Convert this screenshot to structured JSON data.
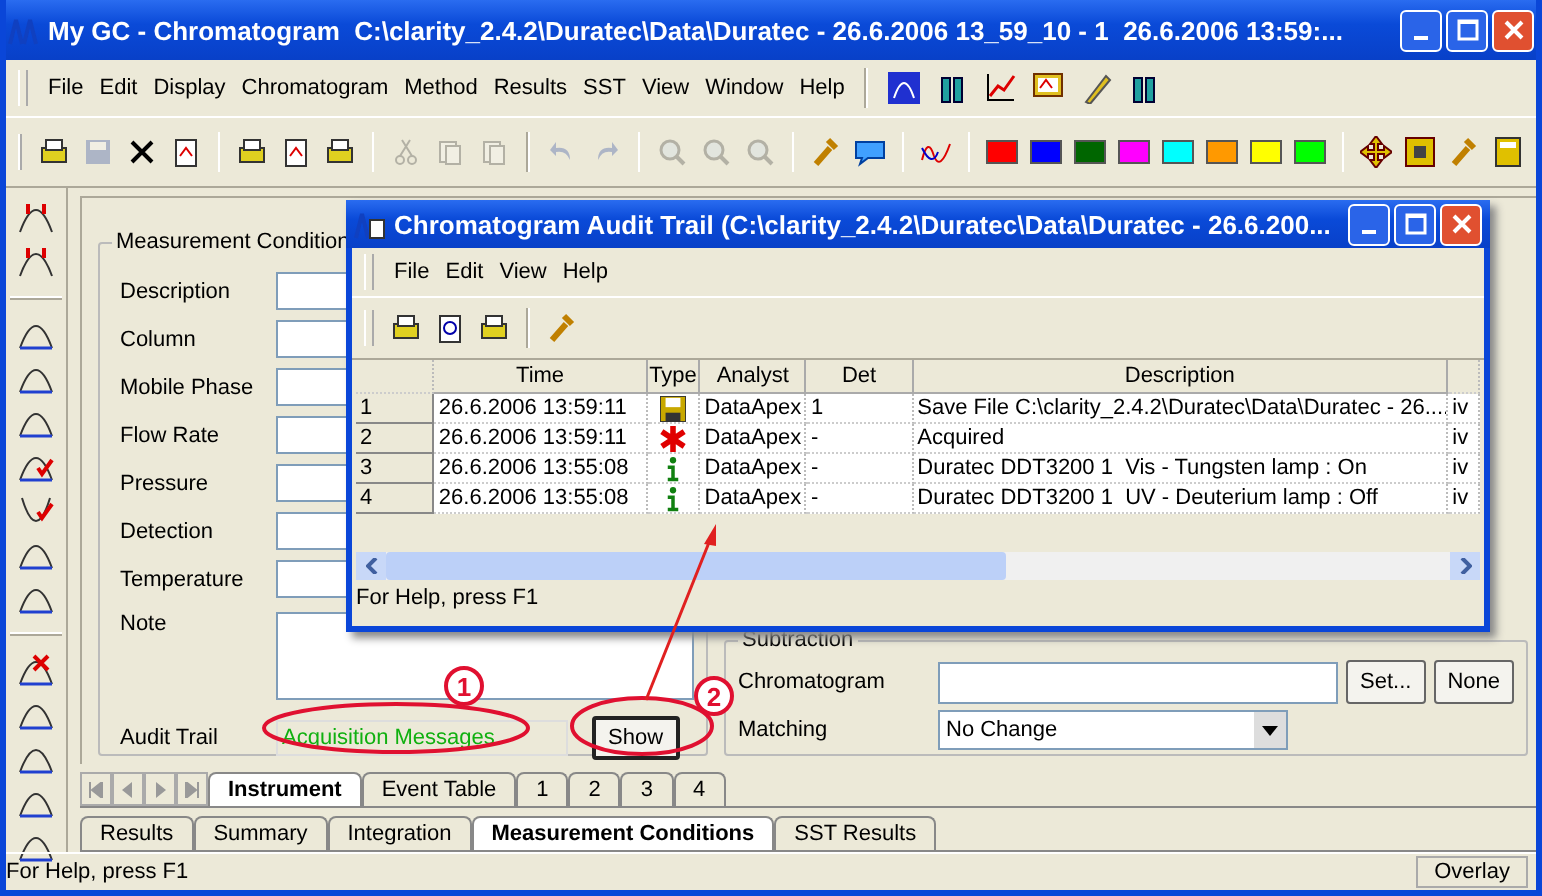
{
  "window": {
    "title": "My GC - Chromatogram  C:\\clarity_2.4.2\\Duratec\\Data\\Duratec - 26.6.2006 13_59_10 - 1  26.6.2006 13:59:..."
  },
  "menu": [
    "File",
    "Edit",
    "Display",
    "Chromatogram",
    "Method",
    "Results",
    "SST",
    "View",
    "Window",
    "Help"
  ],
  "menu_icons": [
    {
      "kind": "peak-box"
    },
    {
      "kind": "vials"
    },
    {
      "kind": "graph"
    },
    {
      "kind": "monitor"
    },
    {
      "kind": "pen"
    },
    {
      "kind": "vials"
    }
  ],
  "toolbar": [
    {
      "kind": "open",
      "disabled": false
    },
    {
      "kind": "save",
      "disabled": true
    },
    {
      "kind": "delete",
      "disabled": false
    },
    {
      "kind": "export",
      "disabled": false
    },
    {
      "kind": "sep"
    },
    {
      "kind": "open",
      "disabled": false
    },
    {
      "kind": "preview",
      "disabled": false
    },
    {
      "kind": "printer",
      "disabled": false
    },
    {
      "kind": "sep"
    },
    {
      "kind": "cut",
      "disabled": true
    },
    {
      "kind": "copy",
      "disabled": true
    },
    {
      "kind": "paste",
      "disabled": true
    },
    {
      "kind": "sep"
    },
    {
      "kind": "undo",
      "disabled": true
    },
    {
      "kind": "redo",
      "disabled": true
    },
    {
      "kind": "sep"
    },
    {
      "kind": "zoom",
      "disabled": true
    },
    {
      "kind": "zoom",
      "disabled": true
    },
    {
      "kind": "zoom",
      "disabled": true
    },
    {
      "kind": "sep"
    },
    {
      "kind": "wrench",
      "disabled": false
    },
    {
      "kind": "comment",
      "disabled": false
    },
    {
      "kind": "sep"
    },
    {
      "kind": "wave",
      "disabled": false
    },
    {
      "kind": "sep"
    },
    {
      "kind": "swatch",
      "color": "#ff0000"
    },
    {
      "kind": "swatch",
      "color": "#0000ff"
    },
    {
      "kind": "swatch",
      "color": "#006600"
    },
    {
      "kind": "swatch",
      "color": "#ff00ff"
    },
    {
      "kind": "swatch",
      "color": "#00ffff"
    },
    {
      "kind": "swatch",
      "color": "#ff9900"
    },
    {
      "kind": "swatch",
      "color": "#ffff00"
    },
    {
      "kind": "swatch",
      "color": "#00ff00"
    },
    {
      "kind": "sep"
    },
    {
      "kind": "move",
      "disabled": false
    },
    {
      "kind": "fit",
      "disabled": false
    },
    {
      "kind": "wrench",
      "disabled": false
    },
    {
      "kind": "calc",
      "disabled": false
    }
  ],
  "side_toolbar": [
    {
      "kind": "peak-mark"
    },
    {
      "kind": "peak-mark"
    },
    {
      "kind": "sep"
    },
    {
      "kind": "peak"
    },
    {
      "kind": "peak"
    },
    {
      "kind": "peak"
    },
    {
      "kind": "peak-check"
    },
    {
      "kind": "valley-check"
    },
    {
      "kind": "peak"
    },
    {
      "kind": "peak"
    },
    {
      "kind": "sep"
    },
    {
      "kind": "peak-cross"
    },
    {
      "kind": "peak"
    },
    {
      "kind": "peak"
    },
    {
      "kind": "peak"
    },
    {
      "kind": "peak"
    }
  ],
  "measurement_conditions": {
    "title": "Measurement Condition",
    "fields": [
      {
        "label": "Description"
      },
      {
        "label": "Column"
      },
      {
        "label": "Mobile Phase"
      },
      {
        "label": "Flow Rate"
      },
      {
        "label": "Pressure"
      },
      {
        "label": "Detection"
      },
      {
        "label": "Temperature"
      }
    ],
    "note_label": "Note",
    "audit_trail": {
      "label": "Audit Trail",
      "value": "Acquisition Messages",
      "button": "Show"
    }
  },
  "subtraction": {
    "title": "Subtraction",
    "chromatogram_label": "Chromatogram",
    "set_button": "Set...",
    "none_button": "None",
    "matching_label": "Matching",
    "matching_value": "No Change"
  },
  "tabs_top": [
    {
      "label": "Instrument",
      "selected": true
    },
    {
      "label": "Event Table",
      "selected": false
    },
    {
      "label": "1",
      "selected": false
    },
    {
      "label": "2",
      "selected": false
    },
    {
      "label": "3",
      "selected": false
    },
    {
      "label": "4",
      "selected": false
    }
  ],
  "tabs_bottom": [
    {
      "label": "Results",
      "selected": false
    },
    {
      "label": "Summary",
      "selected": false
    },
    {
      "label": "Integration",
      "selected": false
    },
    {
      "label": "Measurement Conditions",
      "selected": true
    },
    {
      "label": "SST Results",
      "selected": false
    }
  ],
  "status_bar": {
    "text": "For Help, press F1",
    "mode": "Overlay"
  },
  "audit_window": {
    "title": "Chromatogram Audit Trail (C:\\clarity_2.4.2\\Duratec\\Data\\Duratec - 26.6.200...",
    "menu": [
      "File",
      "Edit",
      "View",
      "Help"
    ],
    "toolbar": [
      {
        "kind": "open"
      },
      {
        "kind": "preview"
      },
      {
        "kind": "printer"
      },
      {
        "kind": "sep"
      },
      {
        "kind": "wrench"
      }
    ],
    "columns": [
      "Time",
      "Type",
      "Analyst",
      "Det",
      "Description"
    ],
    "rows": [
      {
        "index": "1",
        "time": "26.6.2006 13:59:11",
        "kind": "save",
        "analyst": "DataApex",
        "det": "1",
        "description": "Save File C:\\clarity_2.4.2\\Duratec\\Data\\Duratec - 26....",
        "column_7": "iv"
      },
      {
        "index": "2",
        "time": "26.6.2006 13:59:11",
        "kind": "acquired",
        "analyst": "DataApex",
        "det": "-",
        "description": "Acquired",
        "column_7": "iv"
      },
      {
        "index": "3",
        "time": "26.6.2006 13:55:08",
        "kind": "info",
        "analyst": "DataApex",
        "det": "-",
        "description": "Duratec DDT3200 1  Vis - Tungsten lamp : On",
        "column_7": "iv"
      },
      {
        "index": "4",
        "time": "26.6.2006 13:55:08",
        "kind": "info",
        "analyst": "DataApex",
        "det": "-",
        "description": "Duratec DDT3200 1  UV - Deuterium lamp : Off",
        "column_7": "iv"
      }
    ],
    "status": "For Help, press F1"
  },
  "annotations": [
    {
      "number": "1"
    },
    {
      "number": "2"
    }
  ]
}
